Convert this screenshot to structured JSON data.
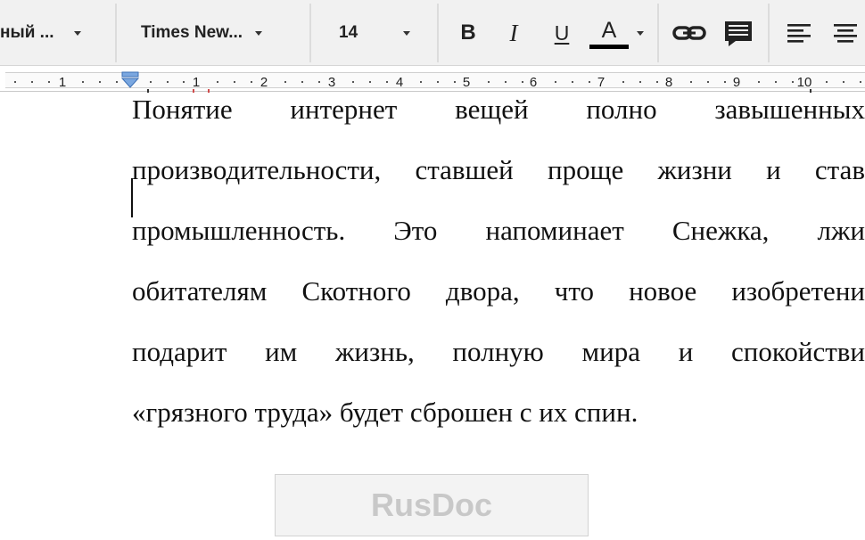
{
  "toolbar": {
    "style_dropdown": "ный ...",
    "font_dropdown": "Times New...",
    "size_dropdown": "14",
    "bold_label": "B",
    "italic_label": "I",
    "underline_label": "U",
    "text_color_label": "A",
    "text_color": "#000000"
  },
  "ruler": {
    "labels": [
      "1",
      "1",
      "2",
      "3",
      "4",
      "5",
      "6",
      "7",
      "8",
      "9",
      "10"
    ]
  },
  "document": {
    "lines": [
      "Понятие интернет вещей полно завышенных",
      "производительности, ставшей проще жизни и став",
      "промышленность. Это напоминает Снежка, лжи",
      "обитателям Скотного двора, что новое изобретени",
      "подарит им жизнь, полную мира и спокойстви",
      "«грязного труда» будет сброшен с их спин."
    ]
  },
  "watermark": {
    "text": "RusDoc"
  }
}
